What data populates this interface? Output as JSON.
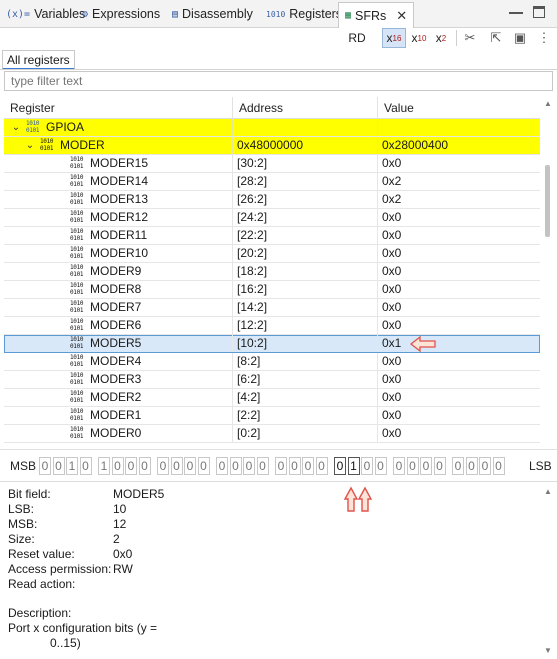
{
  "tabs": [
    {
      "icon": "(x)=",
      "label": "Variables"
    },
    {
      "icon": "⚙",
      "label": "Expressions"
    },
    {
      "icon": "▤",
      "label": "Disassembly"
    },
    {
      "icon": "1010",
      "label": "Registers"
    },
    {
      "icon": "▦",
      "label": "SFRs"
    }
  ],
  "toolbar": {
    "rd": "RD",
    "x16": {
      "base": "x",
      "sub": "16"
    },
    "x10": {
      "base": "x",
      "sub": "10"
    },
    "x2": {
      "base": "x",
      "sub": "2"
    }
  },
  "subtab": "All registers",
  "filter": {
    "placeholder": "type filter text"
  },
  "columns": [
    "Register",
    "Address",
    "Value"
  ],
  "rows": [
    {
      "name": "GPIOA",
      "address": "",
      "value": "",
      "level": 1,
      "kind": "group",
      "highlight": true
    },
    {
      "name": "MODER",
      "address": "0x48000000",
      "value": "0x28000400",
      "level": 2,
      "kind": "register",
      "highlight": true
    },
    {
      "name": "MODER15",
      "address": "[30:2]",
      "value": "0x0",
      "level": 3,
      "kind": "field"
    },
    {
      "name": "MODER14",
      "address": "[28:2]",
      "value": "0x2",
      "level": 3,
      "kind": "field"
    },
    {
      "name": "MODER13",
      "address": "[26:2]",
      "value": "0x2",
      "level": 3,
      "kind": "field"
    },
    {
      "name": "MODER12",
      "address": "[24:2]",
      "value": "0x0",
      "level": 3,
      "kind": "field"
    },
    {
      "name": "MODER11",
      "address": "[22:2]",
      "value": "0x0",
      "level": 3,
      "kind": "field"
    },
    {
      "name": "MODER10",
      "address": "[20:2]",
      "value": "0x0",
      "level": 3,
      "kind": "field"
    },
    {
      "name": "MODER9",
      "address": "[18:2]",
      "value": "0x0",
      "level": 3,
      "kind": "field"
    },
    {
      "name": "MODER8",
      "address": "[16:2]",
      "value": "0x0",
      "level": 3,
      "kind": "field"
    },
    {
      "name": "MODER7",
      "address": "[14:2]",
      "value": "0x0",
      "level": 3,
      "kind": "field"
    },
    {
      "name": "MODER6",
      "address": "[12:2]",
      "value": "0x0",
      "level": 3,
      "kind": "field"
    },
    {
      "name": "MODER5",
      "address": "[10:2]",
      "value": "0x1",
      "level": 3,
      "kind": "field",
      "selected": true
    },
    {
      "name": "MODER4",
      "address": "[8:2]",
      "value": "0x0",
      "level": 3,
      "kind": "field"
    },
    {
      "name": "MODER3",
      "address": "[6:2]",
      "value": "0x0",
      "level": 3,
      "kind": "field"
    },
    {
      "name": "MODER2",
      "address": "[4:2]",
      "value": "0x0",
      "level": 3,
      "kind": "field"
    },
    {
      "name": "MODER1",
      "address": "[2:2]",
      "value": "0x0",
      "level": 3,
      "kind": "field"
    },
    {
      "name": "MODER0",
      "address": "[0:2]",
      "value": "0x0",
      "level": 3,
      "kind": "field"
    }
  ],
  "bits": {
    "msb_label": "MSB",
    "lsb_label": "LSB",
    "values": [
      "0",
      "0",
      "1",
      "0",
      "1",
      "0",
      "0",
      "0",
      "0",
      "0",
      "0",
      "0",
      "0",
      "0",
      "0",
      "0",
      "0",
      "0",
      "0",
      "0",
      "0",
      "1",
      "0",
      "0",
      "0",
      "0",
      "0",
      "0",
      "0",
      "0",
      "0",
      "0"
    ],
    "emphasized": [
      20,
      21
    ]
  },
  "details": {
    "bit_field": {
      "label": "Bit field:",
      "value": "MODER5"
    },
    "lsb": {
      "label": "LSB:",
      "value": "10"
    },
    "msb": {
      "label": "MSB:",
      "value": "12"
    },
    "size": {
      "label": "Size:",
      "value": "2"
    },
    "reset": {
      "label": "Reset value:",
      "value": "0x0"
    },
    "access": {
      "label": "Access permission:",
      "value": "RW"
    },
    "read_action": {
      "label": "Read action:",
      "value": ""
    },
    "description_label": "Description:",
    "description_line1": "Port x configuration bits (y =",
    "description_line2": "0..15)"
  },
  "colors": {
    "highlight": "#ffff00",
    "selection": "#d9e8f8",
    "arrow": "#e0524a"
  }
}
